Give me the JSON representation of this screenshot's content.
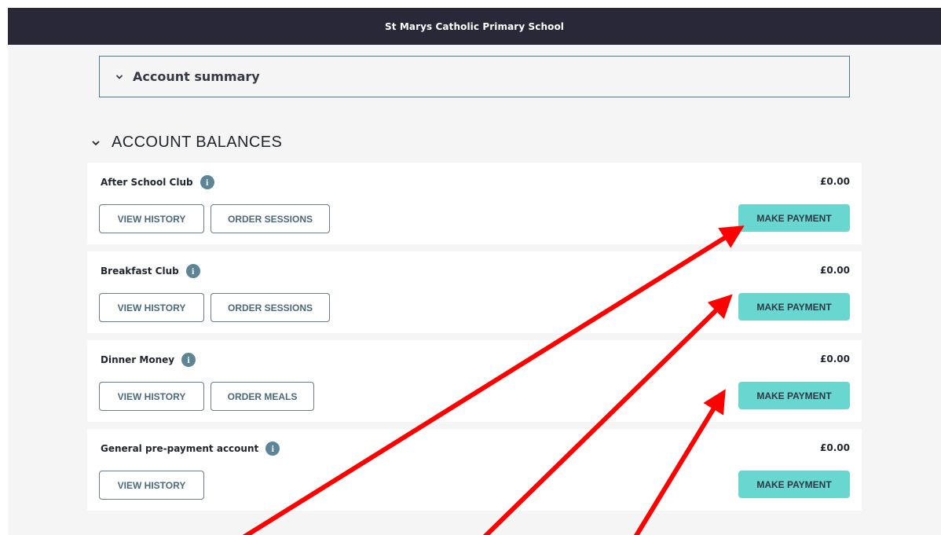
{
  "header": {
    "school_name": "St Marys Catholic Primary School"
  },
  "summary": {
    "label": "Account summary",
    "icon": "chevron-down-icon"
  },
  "balances": {
    "heading": "ACCOUNT BALANCES",
    "accounts": [
      {
        "name": "After School Club",
        "amount": "£0.00",
        "history_label": "VIEW HISTORY",
        "order_label": "ORDER SESSIONS",
        "pay_label": "MAKE PAYMENT"
      },
      {
        "name": "Breakfast Club",
        "amount": "£0.00",
        "history_label": "VIEW HISTORY",
        "order_label": "ORDER SESSIONS",
        "pay_label": "MAKE PAYMENT"
      },
      {
        "name": "Dinner Money",
        "amount": "£0.00",
        "history_label": "VIEW HISTORY",
        "order_label": "ORDER MEALS",
        "pay_label": "MAKE PAYMENT"
      },
      {
        "name": "General pre-payment account",
        "amount": "£0.00",
        "history_label": "VIEW HISTORY",
        "pay_label": "MAKE PAYMENT"
      }
    ]
  },
  "info_icon_glyph": "i",
  "colors": {
    "header_bg": "#292838",
    "pay_button": "#69d6d0",
    "info_icon": "#5e8596",
    "annotation_arrow": "#ff0000"
  }
}
